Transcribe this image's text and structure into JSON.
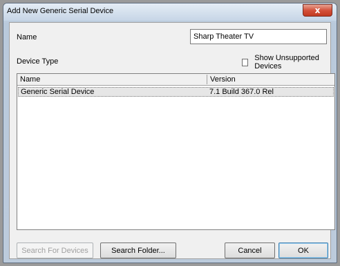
{
  "window": {
    "title": "Add New Generic Serial Device",
    "close_glyph": "x"
  },
  "form": {
    "name_label": "Name",
    "name_value": "Sharp Theater TV",
    "device_type_label": "Device Type",
    "show_unsupported_label": "Show Unsupported Devices",
    "show_unsupported_checked": false
  },
  "table": {
    "columns": [
      "Name",
      "Version"
    ],
    "rows": [
      {
        "name": "Generic Serial Device",
        "version": "7.1 Build 367.0 Rel",
        "selected": true
      }
    ]
  },
  "buttons": {
    "search_devices": "Search For Devices",
    "search_folder": "Search Folder...",
    "cancel": "Cancel",
    "ok": "OK"
  },
  "colors": {
    "accent_close": "#c23a21",
    "selection_bg": "#e6e6e6"
  }
}
